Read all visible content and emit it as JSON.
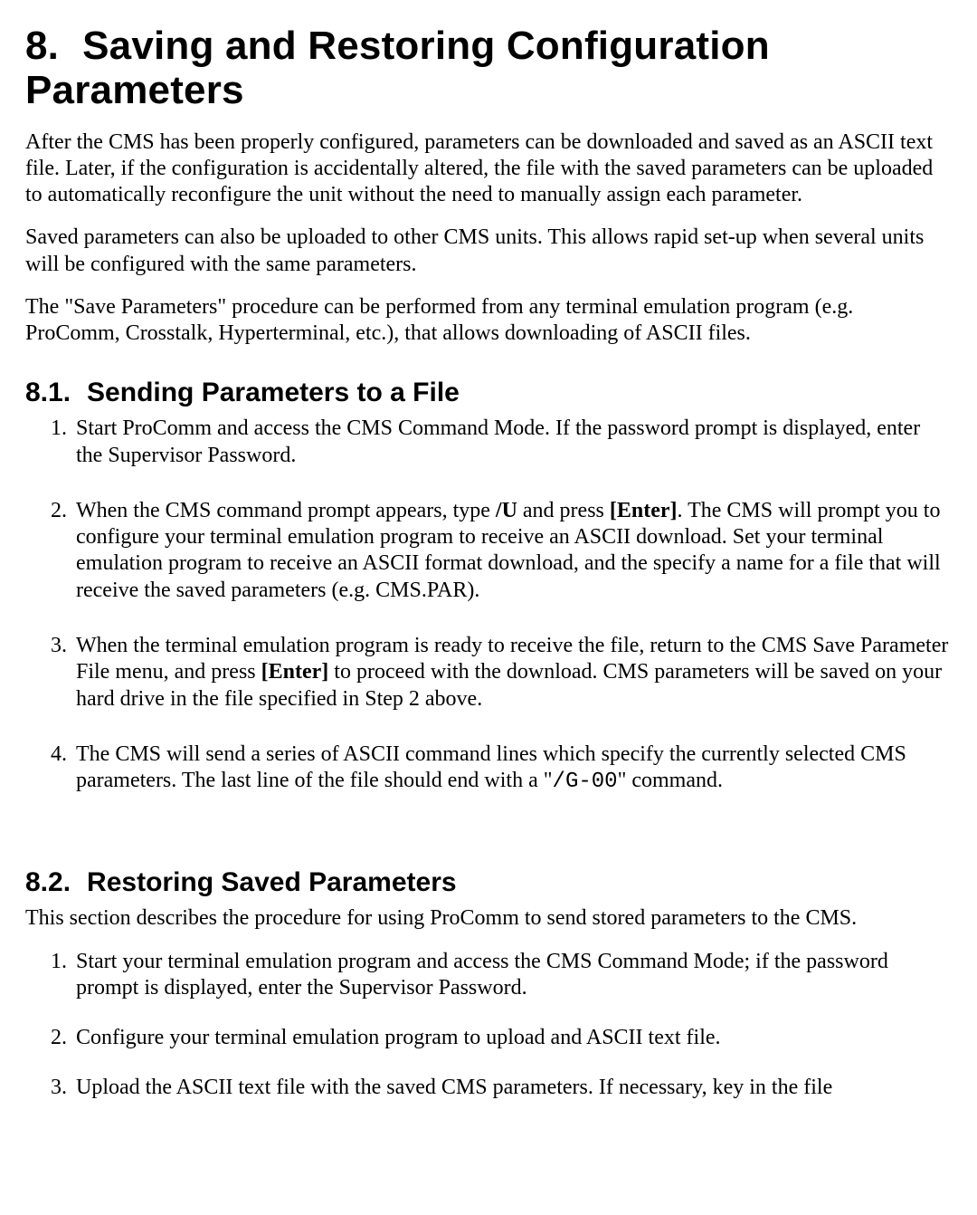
{
  "title": {
    "num": "8.",
    "text": "Saving and Restoring Configuration Parameters"
  },
  "intro": {
    "p1": "After the CMS has been properly configured, parameters can be downloaded and saved as an ASCII text file.  Later, if the configuration is accidentally altered, the file with the saved parameters can be uploaded to automatically reconfigure the unit without the need to manually assign each parameter.",
    "p2": "Saved parameters can also be uploaded to other CMS units.  This allows rapid set-up when several units will be configured with the same parameters.",
    "p3": "The \"Save Parameters\" procedure can be performed from any terminal emulation program (e.g. ProComm, Crosstalk, Hyperterminal, etc.), that allows downloading of ASCII files."
  },
  "sec81": {
    "num": "8.1.",
    "title": "Sending Parameters to a File",
    "items": {
      "i1": "Start ProComm and access the CMS Command Mode. If the password prompt is displayed, enter the Supervisor Password.",
      "i2a": "When the CMS command prompt appears, type ",
      "i2_cmd": "/U",
      "i2b": " and press ",
      "i2_key": "[Enter]",
      "i2c": ". The CMS will prompt you to configure your terminal emulation program to receive an ASCII download. Set your terminal emulation program to receive an ASCII format download, and the specify a name for a file that will receive the saved parameters (e.g. CMS.PAR).",
      "i3a": "When the terminal emulation program is ready to receive the file, return to the CMS Save Parameter File menu, and press ",
      "i3_key": "[Enter]",
      "i3b": " to proceed with the download. CMS parameters will be saved on your hard drive in the file specified in Step 2 above.",
      "i4a": "The CMS will send a series of ASCII command lines which specify the currently selected CMS parameters. The last line of the file should end with a \"",
      "i4_mono": "/G-00",
      "i4b": "\" command."
    }
  },
  "sec82": {
    "num": "8.2.",
    "title": "Restoring Saved Parameters",
    "lead": "This section describes the procedure for using ProComm to send stored parameters to the CMS.",
    "items": {
      "i1": "Start your terminal emulation program and access the CMS Command Mode; if the password prompt is displayed, enter the Supervisor Password.",
      "i2": "Configure your terminal emulation program to upload and ASCII text file.",
      "i3": "Upload the ASCII text file with the saved CMS parameters. If necessary, key in the file"
    }
  }
}
